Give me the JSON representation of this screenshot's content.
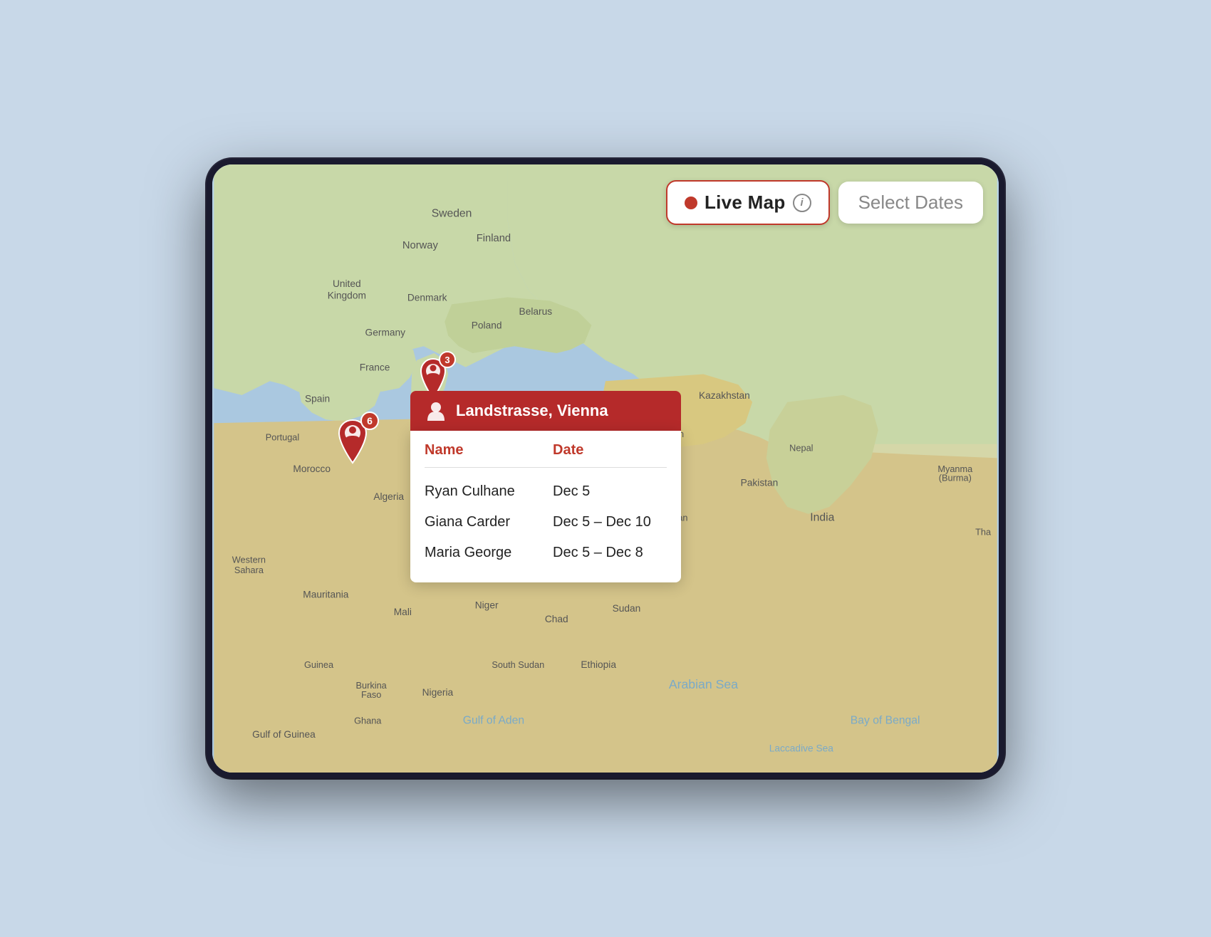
{
  "header": {
    "live_map_label": "Live Map",
    "select_dates_label": "Select Dates",
    "info_icon_label": "i"
  },
  "map": {
    "cluster_spain": {
      "badge": "6"
    },
    "cluster_vienna": {
      "badge": "3",
      "location": "Landstrasse, Vienna"
    }
  },
  "popup": {
    "location": "Landstrasse, Vienna",
    "col_name": "Name",
    "col_date": "Date",
    "rows": [
      {
        "name": "Ryan Culhane",
        "date": "Dec 5"
      },
      {
        "name": "Giana Carder",
        "date": "Dec 5 – Dec 10"
      },
      {
        "name": "Maria George",
        "date": "Dec 5 – Dec 8"
      }
    ]
  }
}
